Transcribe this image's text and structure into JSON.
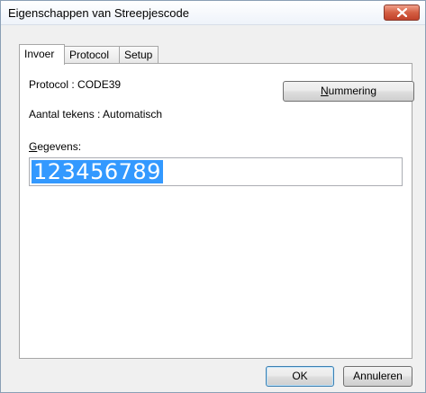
{
  "window": {
    "title": "Eigenschappen van Streepjescode"
  },
  "tabs": [
    {
      "label": "Invoer",
      "active": true
    },
    {
      "label": "Protocol",
      "active": false
    },
    {
      "label": "Setup",
      "active": false
    }
  ],
  "invoer": {
    "protocol_text": "Protocol : CODE39",
    "aantal_text": "Aantal tekens : Automatisch",
    "nummering_button": {
      "first": "N",
      "rest": "ummering"
    },
    "gegevens_label": {
      "first": "G",
      "rest": "egevens:"
    },
    "gegevens_value": "123456789"
  },
  "footer": {
    "ok_label": "OK",
    "cancel_label": "Annuleren"
  },
  "colors": {
    "selection": "#3399ff",
    "close_button": "#c74b32"
  }
}
